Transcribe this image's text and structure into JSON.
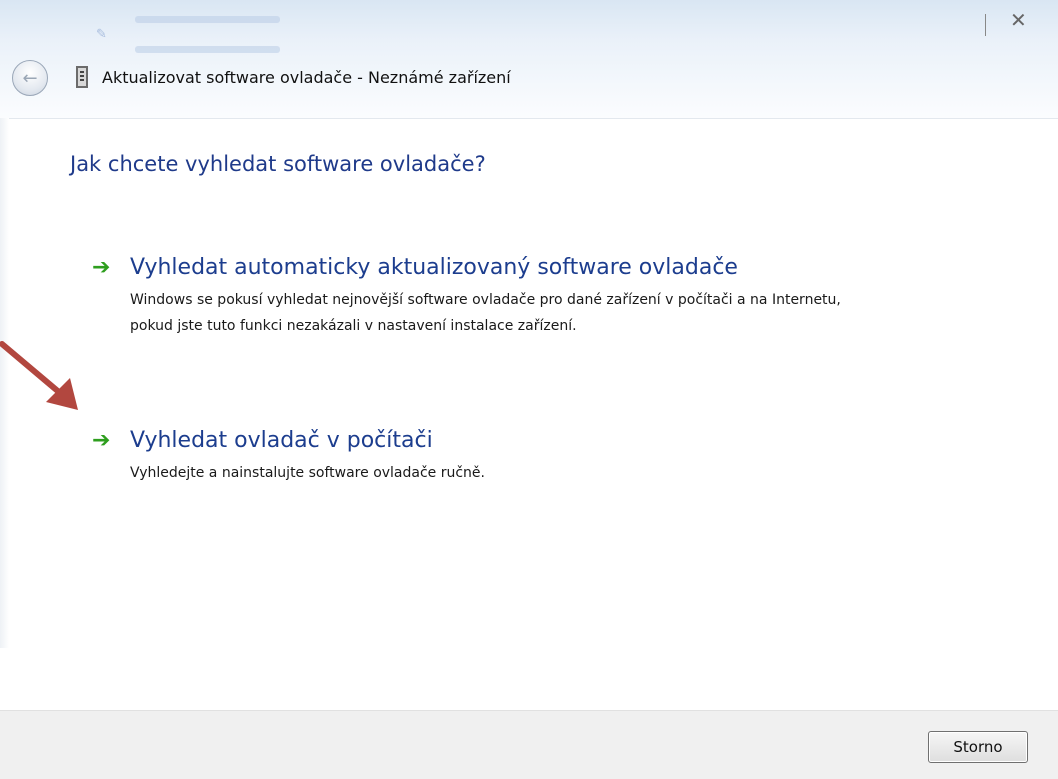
{
  "window": {
    "title": "Aktualizovat software ovladače - Neznámé zařízení",
    "close_glyph": "✕",
    "back_glyph": "←"
  },
  "content": {
    "heading": "Jak chcete vyhledat software ovladače?",
    "options": [
      {
        "title": "Vyhledat automaticky aktualizovaný software ovladače",
        "description": "Windows se pokusí vyhledat nejnovější software ovladače pro dané zařízení v počítači a na Internetu, pokud jste tuto funkci nezakázali v nastavení instalace zařízení.",
        "icon": "green-arrow-icon"
      },
      {
        "title": "Vyhledat ovladač v počítači",
        "description": "Vyhledejte a nainstalujte software ovladače ručně.",
        "icon": "green-arrow-icon"
      }
    ]
  },
  "footer": {
    "cancel_label": "Storno"
  },
  "colors": {
    "heading": "#1f3a8a",
    "option_title": "#1c3d8e",
    "option_arrow": "#2e9e1e",
    "annotation_arrow": "#b2473f",
    "footer_bg": "#f0f0f0"
  }
}
